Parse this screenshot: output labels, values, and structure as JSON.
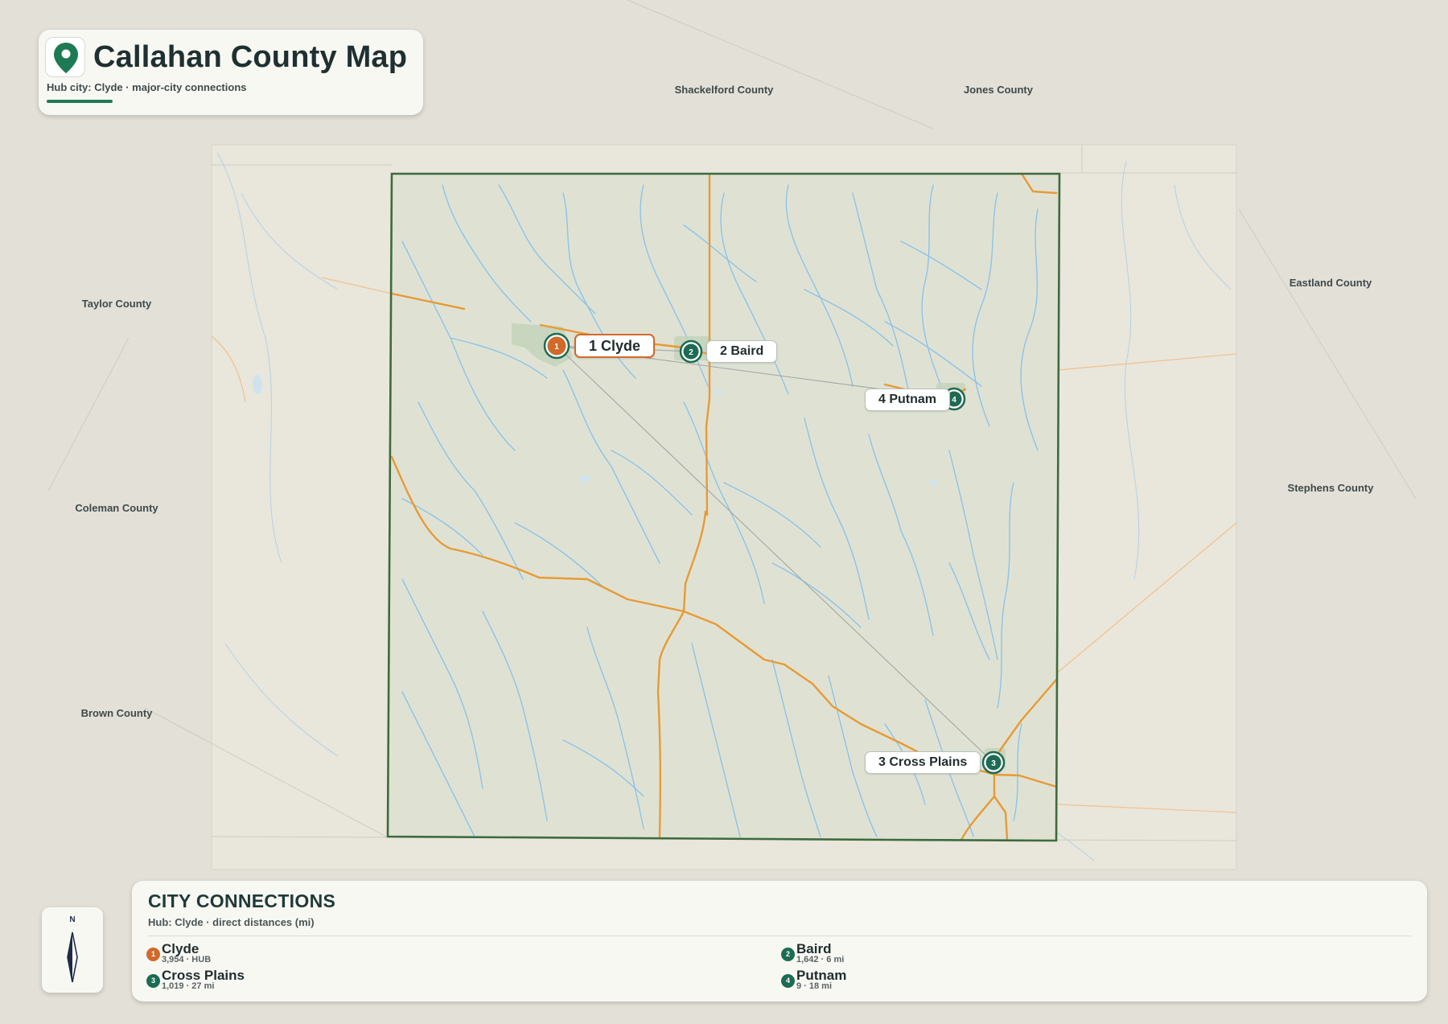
{
  "title": "Callahan County Map",
  "subtitle": "Hub city: Clyde · major-city connections",
  "neighbor_counties": [
    "Shackelford County",
    "Jones County",
    "Taylor County",
    "Eastland County",
    "Coleman County",
    "Stephens County",
    "Brown County"
  ],
  "cities": [
    {
      "num": "1",
      "name": "Clyde",
      "label": "1 Clyde",
      "hub": true
    },
    {
      "num": "2",
      "name": "Baird",
      "label": "2 Baird",
      "hub": false
    },
    {
      "num": "3",
      "name": "Cross Plains",
      "label": "3 Cross Plains",
      "hub": false
    },
    {
      "num": "4",
      "name": "Putnam",
      "label": "4 Putnam",
      "hub": false
    }
  ],
  "legend": {
    "title": "CITY CONNECTIONS",
    "subtitle": "Hub: Clyde · direct distances (mi)",
    "entries": [
      {
        "num": "1",
        "name": "Clyde",
        "detail": "3,954 · HUB",
        "hub": true
      },
      {
        "num": "2",
        "name": "Baird",
        "detail": "1,642 · 6 mi",
        "hub": false
      },
      {
        "num": "3",
        "name": "Cross Plains",
        "detail": "1,019 · 27 mi",
        "hub": false
      },
      {
        "num": "4",
        "name": "Putnam",
        "detail": "9 · 18 mi",
        "hub": false
      }
    ]
  },
  "compass_label": "N",
  "colors": {
    "hub": "#d06a2b",
    "city": "#1d6b52",
    "county_border": "#3d6b3c",
    "road": "#e89a35",
    "water": "#8dc3e8",
    "title_accent": "#1e7a55"
  },
  "icons": {
    "title": "map-pin-icon",
    "compass": "compass-arrow-icon"
  }
}
